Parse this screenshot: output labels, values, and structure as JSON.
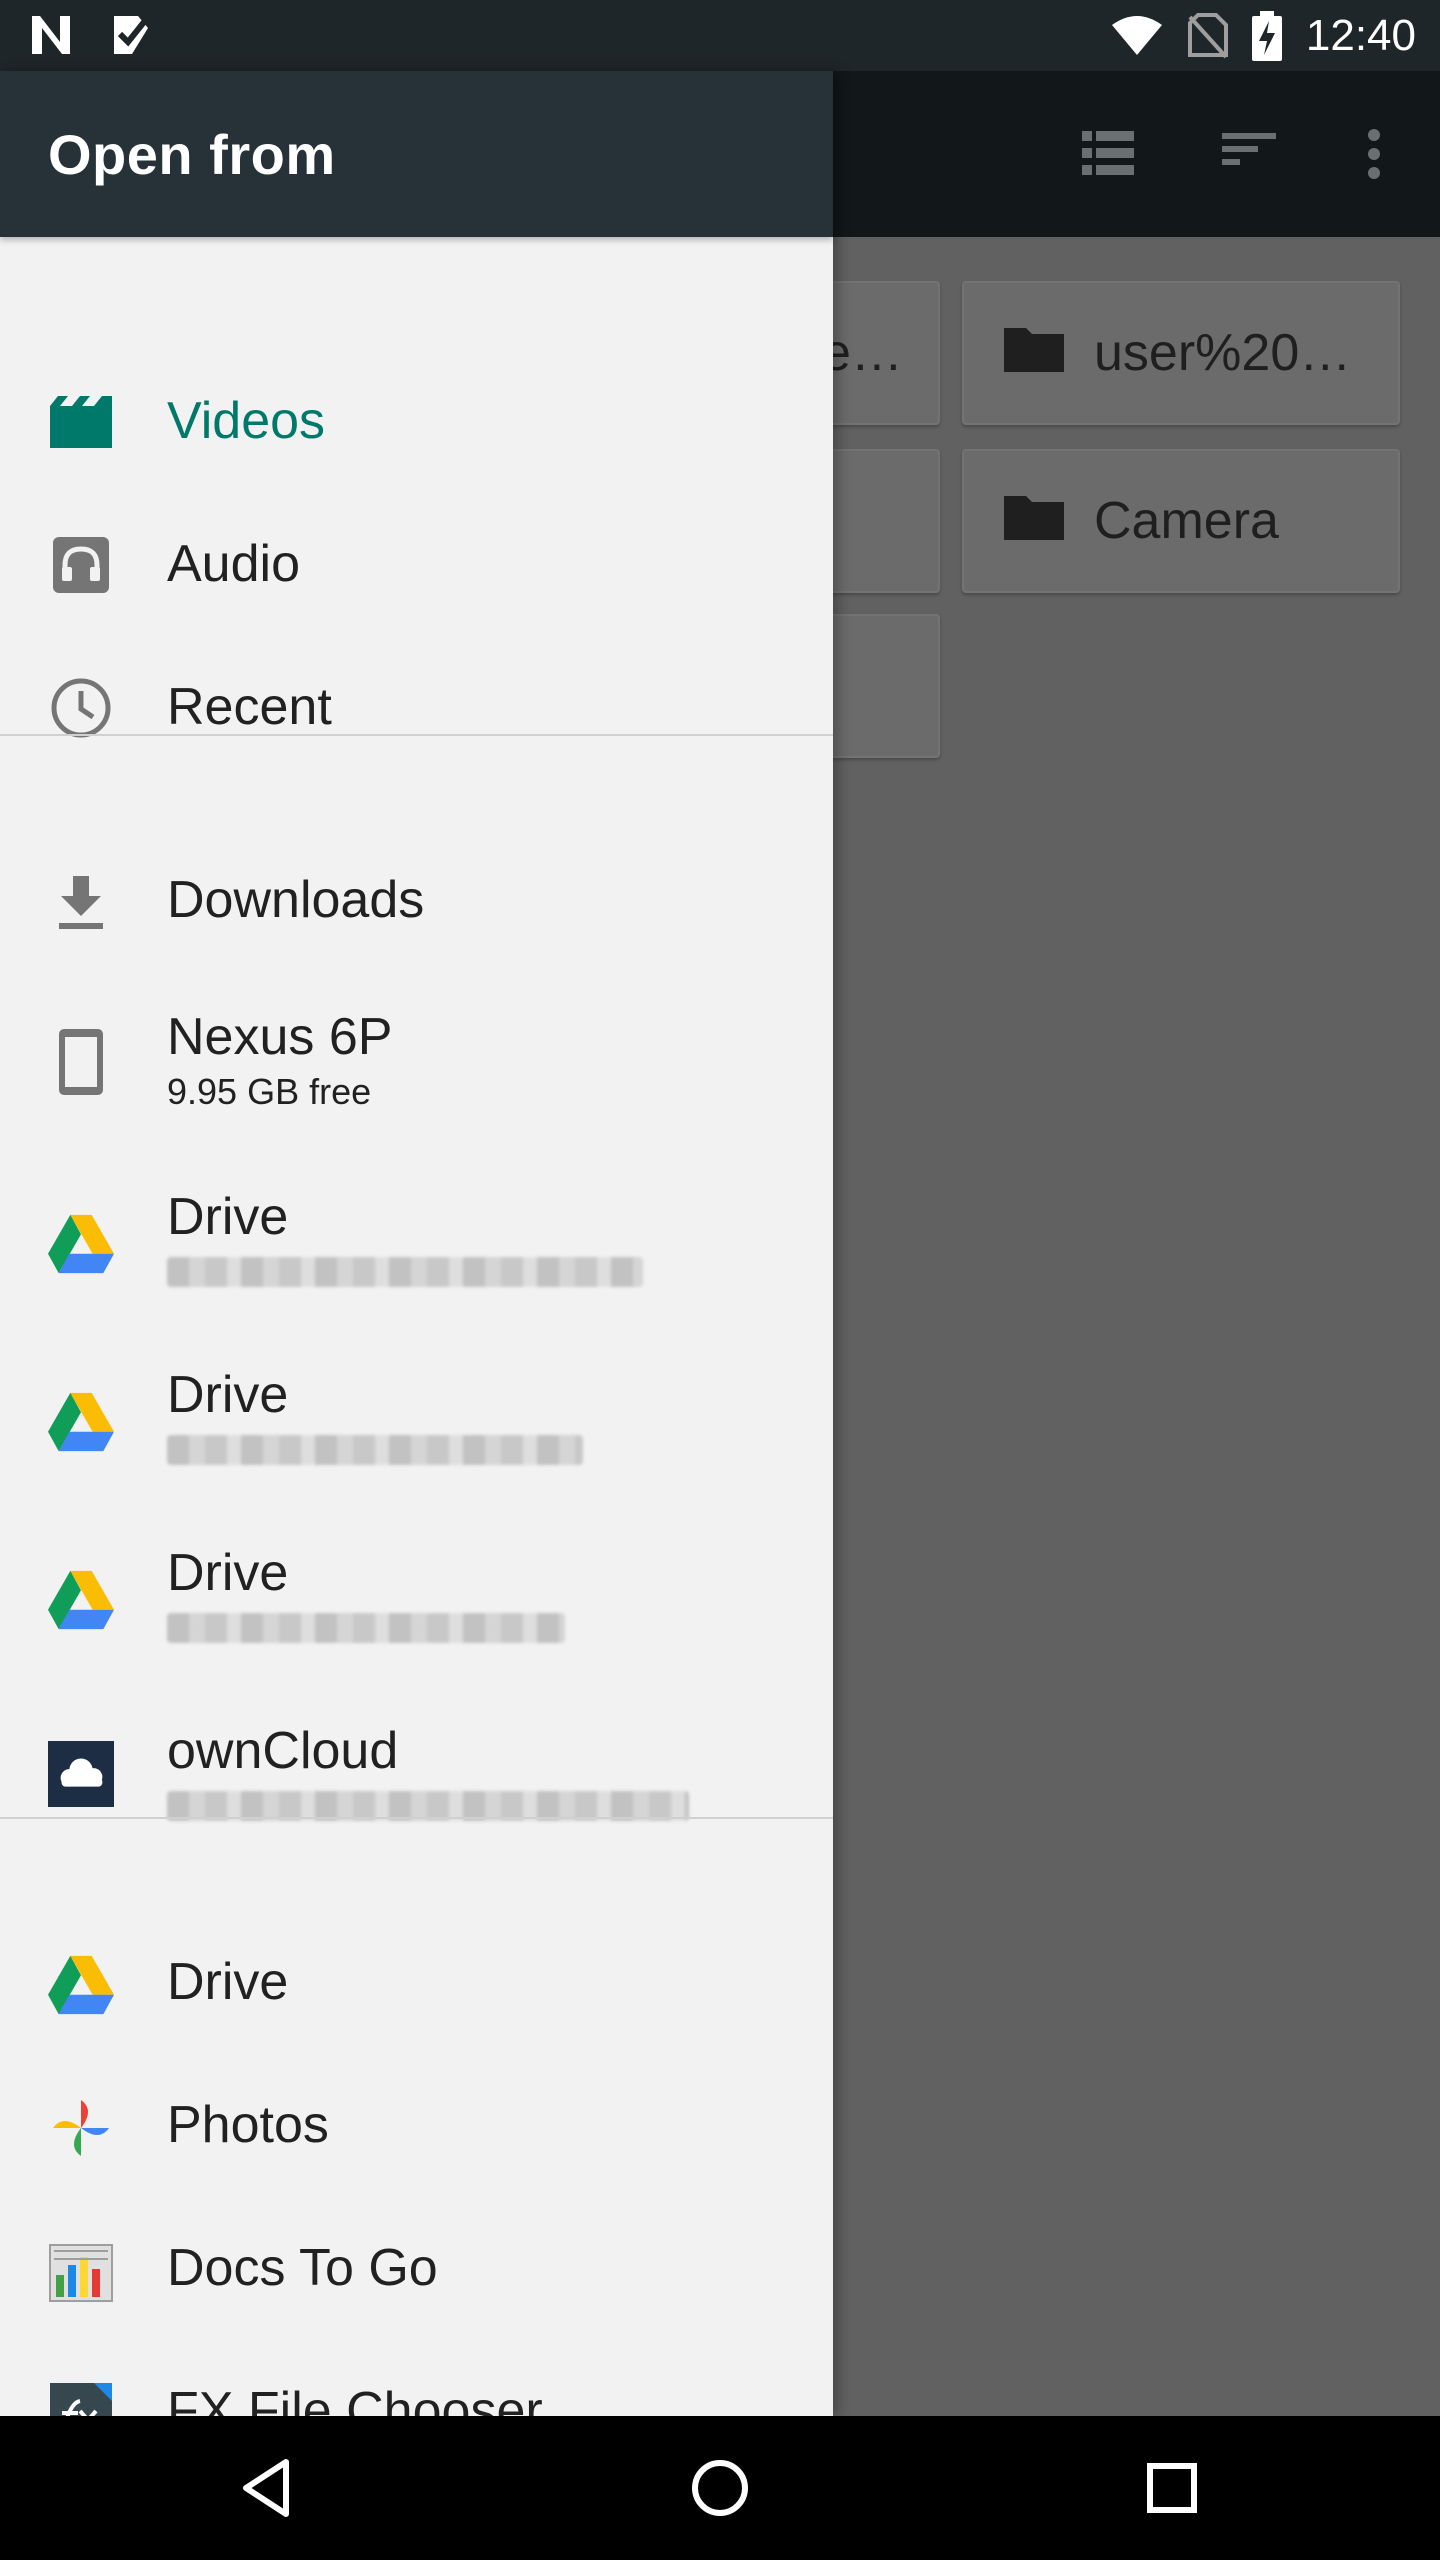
{
  "status_bar": {
    "time": "12:40",
    "left_icons": [
      "n-notification-icon",
      "check-notification-icon"
    ],
    "right_icons": [
      "wifi-icon",
      "no-sim-icon",
      "battery-charging-icon"
    ]
  },
  "background_app": {
    "toolbar_icons": [
      "list-view-icon",
      "sort-icon",
      "more-vert-icon"
    ],
    "folders": [
      {
        "name": "e…"
      },
      {
        "name": "user%20…"
      },
      {
        "name": ""
      },
      {
        "name": "Camera"
      },
      {
        "name": ""
      }
    ]
  },
  "drawer": {
    "title": "Open from",
    "roots": [
      {
        "title": "Videos",
        "icon": "videos-icon",
        "active": true
      },
      {
        "title": "Audio",
        "icon": "headphones-icon"
      },
      {
        "title": "Recent",
        "icon": "clock-icon"
      },
      {
        "title": "Downloads",
        "icon": "download-icon"
      },
      {
        "title": "Nexus 6P",
        "summary": "9.95 GB free",
        "icon": "phone-icon"
      },
      {
        "title": "Drive",
        "icon": "google-drive-icon"
      },
      {
        "title": "Drive",
        "icon": "google-drive-icon"
      },
      {
        "title": "Drive",
        "icon": "google-drive-icon"
      },
      {
        "title": "ownCloud",
        "icon": "owncloud-icon"
      },
      {
        "title": "Drive",
        "icon": "google-drive-icon"
      },
      {
        "title": "Photos",
        "icon": "google-photos-icon"
      },
      {
        "title": "Docs To Go",
        "icon": "docs-to-go-icon"
      },
      {
        "title": "FX File Chooser",
        "icon": "fx-file-chooser-icon"
      }
    ]
  },
  "colors": {
    "accent": "#00796b",
    "header": "#263238",
    "drawer_bg": "#f2f2f2",
    "scrim": "#616161"
  },
  "nav_bar": {
    "buttons": [
      "back-icon",
      "home-icon",
      "recents-icon"
    ]
  }
}
